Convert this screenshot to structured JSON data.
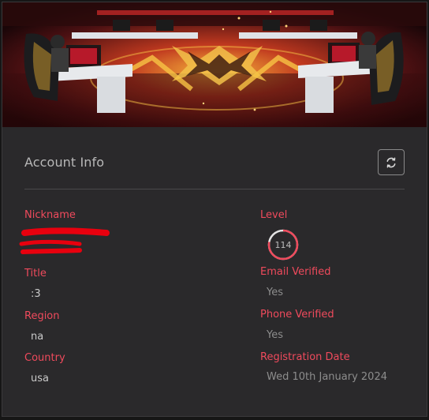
{
  "section": {
    "title": "Account Info"
  },
  "fields": {
    "nickname": {
      "label": "Nickname"
    },
    "title": {
      "label": "Title",
      "value": ":3"
    },
    "region": {
      "label": "Region",
      "value": "na"
    },
    "country": {
      "label": "Country",
      "value": "usa"
    },
    "level": {
      "label": "Level",
      "value": "114",
      "progress": 0.78
    },
    "email_verified": {
      "label": "Email Verified",
      "value": "Yes"
    },
    "phone_verified": {
      "label": "Phone Verified",
      "value": "Yes"
    },
    "registration_date": {
      "label": "Registration Date",
      "value": "Wed 10th January 2024"
    }
  },
  "icons": {
    "refresh": "refresh-icon"
  },
  "colors": {
    "accent": "#ef4a5c",
    "card_bg": "#2a292b",
    "page_bg": "#161616",
    "redaction": "#e8000e"
  }
}
